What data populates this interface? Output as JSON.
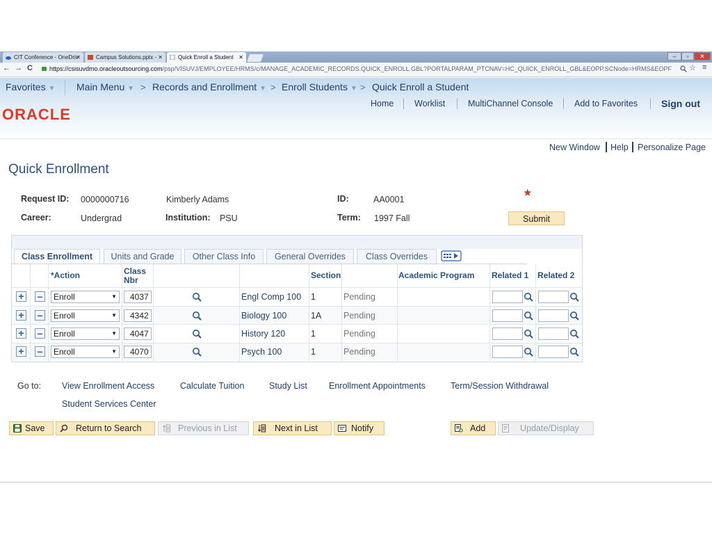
{
  "browser": {
    "tabs": [
      {
        "label": "CIT Conference - OneDriv",
        "active": false
      },
      {
        "label": "Campus Solutions.pptx - ",
        "active": false
      },
      {
        "label": "Quick Enroll a Student",
        "active": true
      }
    ],
    "url_host": "https://csisuvdmo.oracleoutsourcing.com",
    "url_path": "/psp/VISUVJ/EMPLOYEE/HRMS/c/MANAGE_ACADEMIC_RECORDS.QUICK_ENROLL.GBL?PORTALPARAM_PTCNAV=HC_QUICK_ENROLL_GBL&EOPP.SCNode=HRMS&EOPF"
  },
  "nav": {
    "favorites": "Favorites",
    "main_menu": "Main Menu",
    "records": "Records and Enrollment",
    "enroll_students": "Enroll Students",
    "current": "Quick Enroll a Student"
  },
  "brand": {
    "logo_text": "ORACLE"
  },
  "top_links": {
    "home": "Home",
    "worklist": "Worklist",
    "multichannel": "MultiChannel Console",
    "add_favorites": "Add to Favorites",
    "sign_out": "Sign out"
  },
  "page_links": {
    "new_window": "New Window",
    "help": "Help",
    "personalize": "Personalize Page"
  },
  "page": {
    "title": "Quick Enrollment"
  },
  "request": {
    "request_id_label": "Request ID:",
    "request_id": "0000000716",
    "student_name": "Kimberly Adams",
    "id_label": "ID:",
    "id": "AA0001",
    "career_label": "Career:",
    "career": "Undergrad",
    "institution_label": "Institution:",
    "institution": "PSU",
    "term_label": "Term:",
    "term": "1997 Fall",
    "submit": "Submit"
  },
  "grid": {
    "tabs": [
      "Class Enrollment",
      "Units and Grade",
      "Other Class Info",
      "General Overrides",
      "Class Overrides"
    ],
    "active_tab": "Class Enrollment",
    "headers": {
      "action": "*Action",
      "class_nbr_1": "Class",
      "class_nbr_2": "Nbr",
      "section": "Section",
      "academic_program": "Academic Program",
      "related1": "Related 1",
      "related2": "Related 2"
    },
    "rows": [
      {
        "action": "Enroll",
        "class_nbr": "4037",
        "description": "Engl Comp 100",
        "section": "1",
        "status": "Pending"
      },
      {
        "action": "Enroll",
        "class_nbr": "4342",
        "description": "Biology 100",
        "section": "1A",
        "status": "Pending"
      },
      {
        "action": "Enroll",
        "class_nbr": "4047",
        "description": "History 120",
        "section": "1",
        "status": "Pending"
      },
      {
        "action": "Enroll",
        "class_nbr": "4070",
        "description": "Psych 100",
        "section": "1",
        "status": "Pending"
      }
    ]
  },
  "goto": {
    "label": "Go to:",
    "links": [
      "View Enrollment Access",
      "Calculate Tuition",
      "Study List",
      "Enrollment Appointments",
      "Term/Session Withdrawal",
      "Student Services Center"
    ]
  },
  "toolbar": {
    "save": "Save",
    "return_to_search": "Return to Search",
    "previous_in_list": "Previous in List",
    "next_in_list": "Next in List",
    "notify": "Notify",
    "add": "Add",
    "update_display": "Update/Display"
  },
  "colors": {
    "accent": "#29527e",
    "oracle_red": "#e03a24",
    "button": "#fbe9c2"
  }
}
